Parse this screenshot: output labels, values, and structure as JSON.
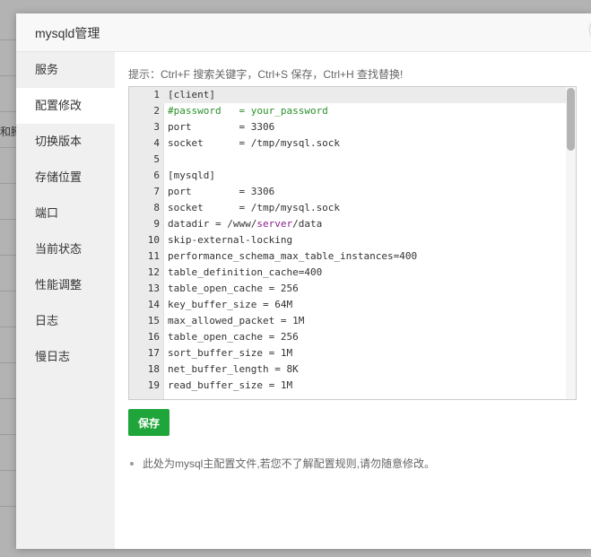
{
  "background": {
    "partial_text": "和腾"
  },
  "dialog": {
    "title": "mysqld管理",
    "close_symbol": "×"
  },
  "sidebar": {
    "items": [
      {
        "label": "服务",
        "active": false
      },
      {
        "label": "配置修改",
        "active": true
      },
      {
        "label": "切换版本",
        "active": false
      },
      {
        "label": "存储位置",
        "active": false
      },
      {
        "label": "端口",
        "active": false
      },
      {
        "label": "当前状态",
        "active": false
      },
      {
        "label": "性能调整",
        "active": false
      },
      {
        "label": "日志",
        "active": false
      },
      {
        "label": "慢日志",
        "active": false
      }
    ]
  },
  "main": {
    "hint": "提示：Ctrl+F 搜索关键字，Ctrl+S 保存，Ctrl+H 查找替换!",
    "editor": {
      "lines": [
        {
          "n": "1",
          "text": "[client]"
        },
        {
          "n": "2",
          "text": "#password   = your_password"
        },
        {
          "n": "3",
          "text": "port        = 3306"
        },
        {
          "n": "4",
          "text": "socket      = /tmp/mysql.sock"
        },
        {
          "n": "5",
          "text": ""
        },
        {
          "n": "6",
          "text": "[mysqld]"
        },
        {
          "n": "7",
          "text": "port        = 3306"
        },
        {
          "n": "8",
          "text": "socket      = /tmp/mysql.sock"
        },
        {
          "n": "9",
          "text_pre": "datadir = /www/",
          "text_kw": "server",
          "text_post": "/data"
        },
        {
          "n": "10",
          "text": "skip-external-locking"
        },
        {
          "n": "11",
          "text": "performance_schema_max_table_instances=400"
        },
        {
          "n": "12",
          "text": "table_definition_cache=400"
        },
        {
          "n": "13",
          "text": "table_open_cache = 256"
        },
        {
          "n": "14",
          "text": "key_buffer_size = 64M"
        },
        {
          "n": "15",
          "text": "max_allowed_packet = 1M"
        },
        {
          "n": "16",
          "text": "table_open_cache = 256"
        },
        {
          "n": "17",
          "text": "sort_buffer_size = 1M"
        },
        {
          "n": "18",
          "text": "net_buffer_length = 8K"
        },
        {
          "n": "19",
          "text": "read_buffer_size = 1M"
        }
      ]
    },
    "save_label": "保存",
    "note": "此处为mysql主配置文件,若您不了解配置规则,请勿随意修改。"
  },
  "colors": {
    "save_button": "#20a53a",
    "comment": "#2a8f2a",
    "keyword": "#8a1f8a"
  }
}
